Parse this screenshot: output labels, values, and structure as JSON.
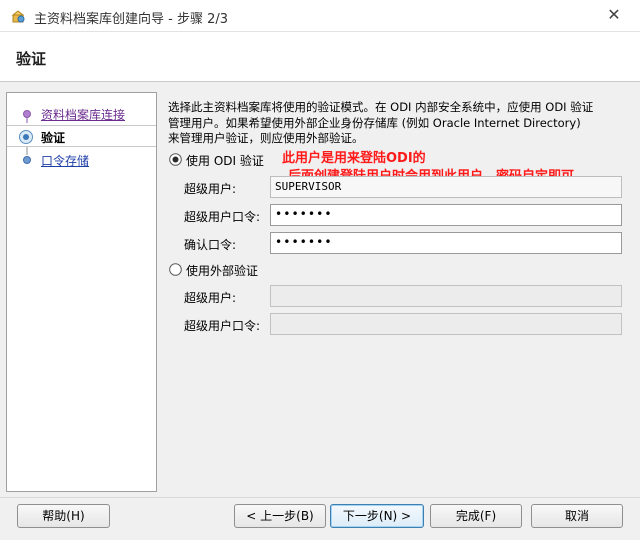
{
  "window": {
    "title": "主资料档案库创建向导 - 步骤 2/3",
    "close_glyph": "✕"
  },
  "header": {
    "title": "验证"
  },
  "nav": {
    "items": [
      {
        "label": "资料档案库连接",
        "state": "visited"
      },
      {
        "label": "验证",
        "state": "current"
      },
      {
        "label": "口令存储",
        "state": "upcoming"
      }
    ]
  },
  "main": {
    "description_line1": "选择此主资料档案库将使用的验证模式。在 ODI 内部安全系统中，应使用 ODI 验证",
    "description_line2": "管理用户。如果希望使用外部企业身份存储库 (例如 Oracle Internet Directory)",
    "description_line3": "来管理用户验证，则应使用外部验证。",
    "odi_auth": {
      "label": "使用 ODI 验证",
      "selected": true,
      "superuser_label": "超级用户:",
      "superuser_value": "SUPERVISOR",
      "password_label": "超级用户口令:",
      "password_value": "•••••••",
      "confirm_label": "确认口令:",
      "confirm_value": "•••••••"
    },
    "external_auth": {
      "label": "使用外部验证",
      "selected": false,
      "superuser_label": "超级用户:",
      "superuser_value": "",
      "password_label": "超级用户口令:",
      "password_value": ""
    },
    "annotation": {
      "line1": "此用户是用来登陆ODI的",
      "line2": "后面创建登陆用户时会用到此用户，密码自定即可",
      "color": "#ff1a1a"
    }
  },
  "buttons": {
    "help": "帮助(H)",
    "back": "< 上一步(B)",
    "next": "下一步(N) >",
    "finish": "完成(F)",
    "cancel": "取消"
  },
  "colors": {
    "visited_link": "#6b2c8f",
    "link": "#1f3fa8",
    "accent": "#3c7fb1"
  }
}
